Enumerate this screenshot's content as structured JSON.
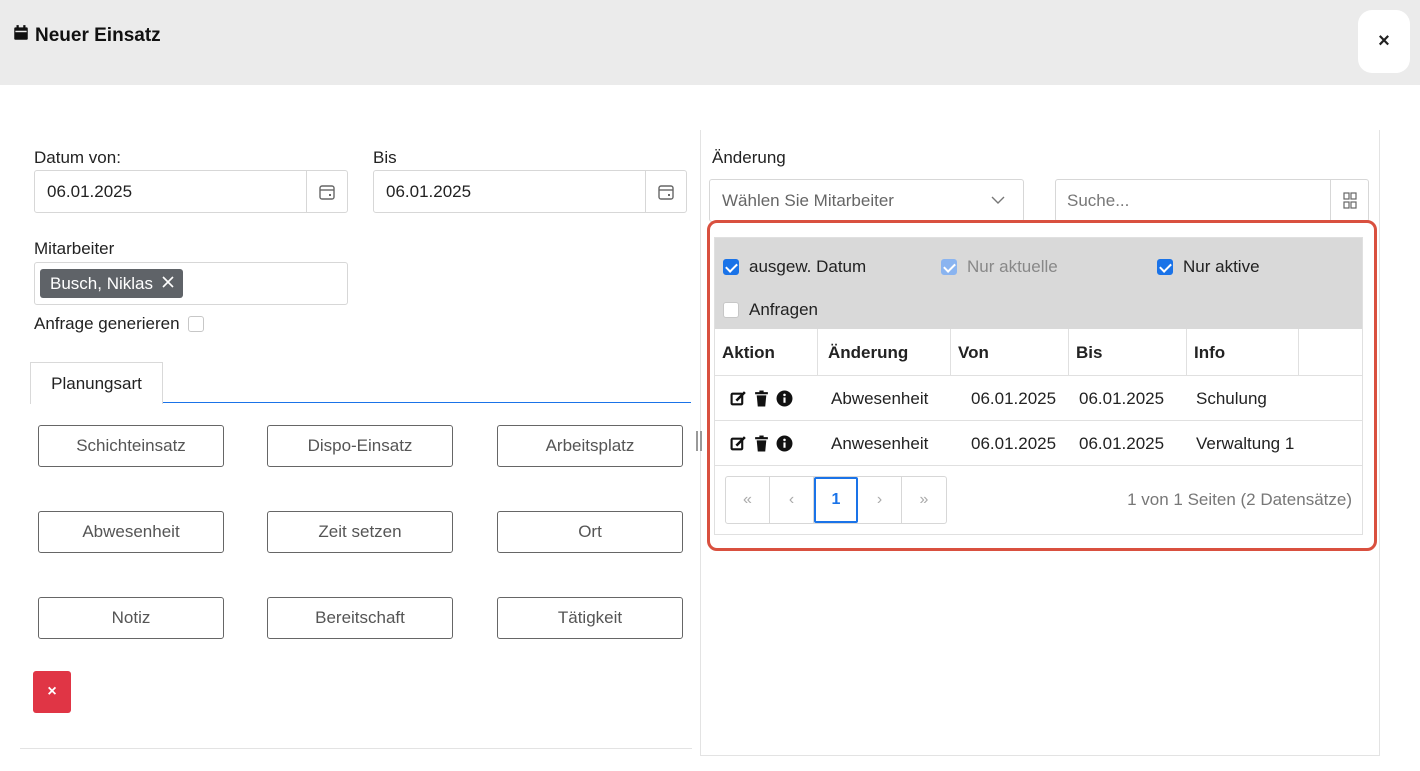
{
  "header": {
    "title": "Neuer Einsatz",
    "close_label": "×"
  },
  "form": {
    "datum_von_label": "Datum von:",
    "datum_von_value": "06.01.2025",
    "bis_label": "Bis",
    "bis_value": "06.01.2025",
    "mitarbeiter_label": "Mitarbeiter",
    "mitarbeiter_tag": "Busch, Niklas",
    "anfrage_label": "Anfrage generieren",
    "anfrage_checked": false
  },
  "tabs": [
    {
      "label": "Planungsart",
      "active": true
    }
  ],
  "buttons": [
    "Schichteinsatz",
    "Dispo-Einsatz",
    "Arbeitsplatz",
    "Abwesenheit",
    "Zeit setzen",
    "Ort",
    "Notiz",
    "Bereitschaft",
    "Tätigkeit"
  ],
  "delete_button_label": "×",
  "right": {
    "label": "Änderung",
    "select_placeholder": "Wählen Sie Mitarbeiter",
    "search_placeholder": "Suche...",
    "filters": [
      {
        "label": "ausgew. Datum",
        "checked": true,
        "disabled": false
      },
      {
        "label": "Nur aktuelle",
        "checked": true,
        "disabled": true
      },
      {
        "label": "Nur aktive",
        "checked": true,
        "disabled": false
      },
      {
        "label": "Anfragen",
        "checked": false,
        "disabled": false
      }
    ],
    "columns": [
      "Aktion",
      "Änderung",
      "Von",
      "Bis",
      "Info"
    ],
    "rows": [
      {
        "aenderung": "Abwesenheit",
        "von": "06.01.2025",
        "bis": "06.01.2025",
        "info": "Schulung"
      },
      {
        "aenderung": "Anwesenheit",
        "von": "06.01.2025",
        "bis": "06.01.2025",
        "info": "Verwaltung 1"
      }
    ],
    "pager": {
      "first": "«",
      "prev": "‹",
      "current": "1",
      "next": "›",
      "last": "»",
      "info": "1 von 1 Seiten (2 Datensätze)"
    }
  },
  "colors": {
    "accent": "#1a73e8",
    "danger": "#e03545",
    "highlight": "#d9503f",
    "header_bg": "#ebebeb"
  }
}
